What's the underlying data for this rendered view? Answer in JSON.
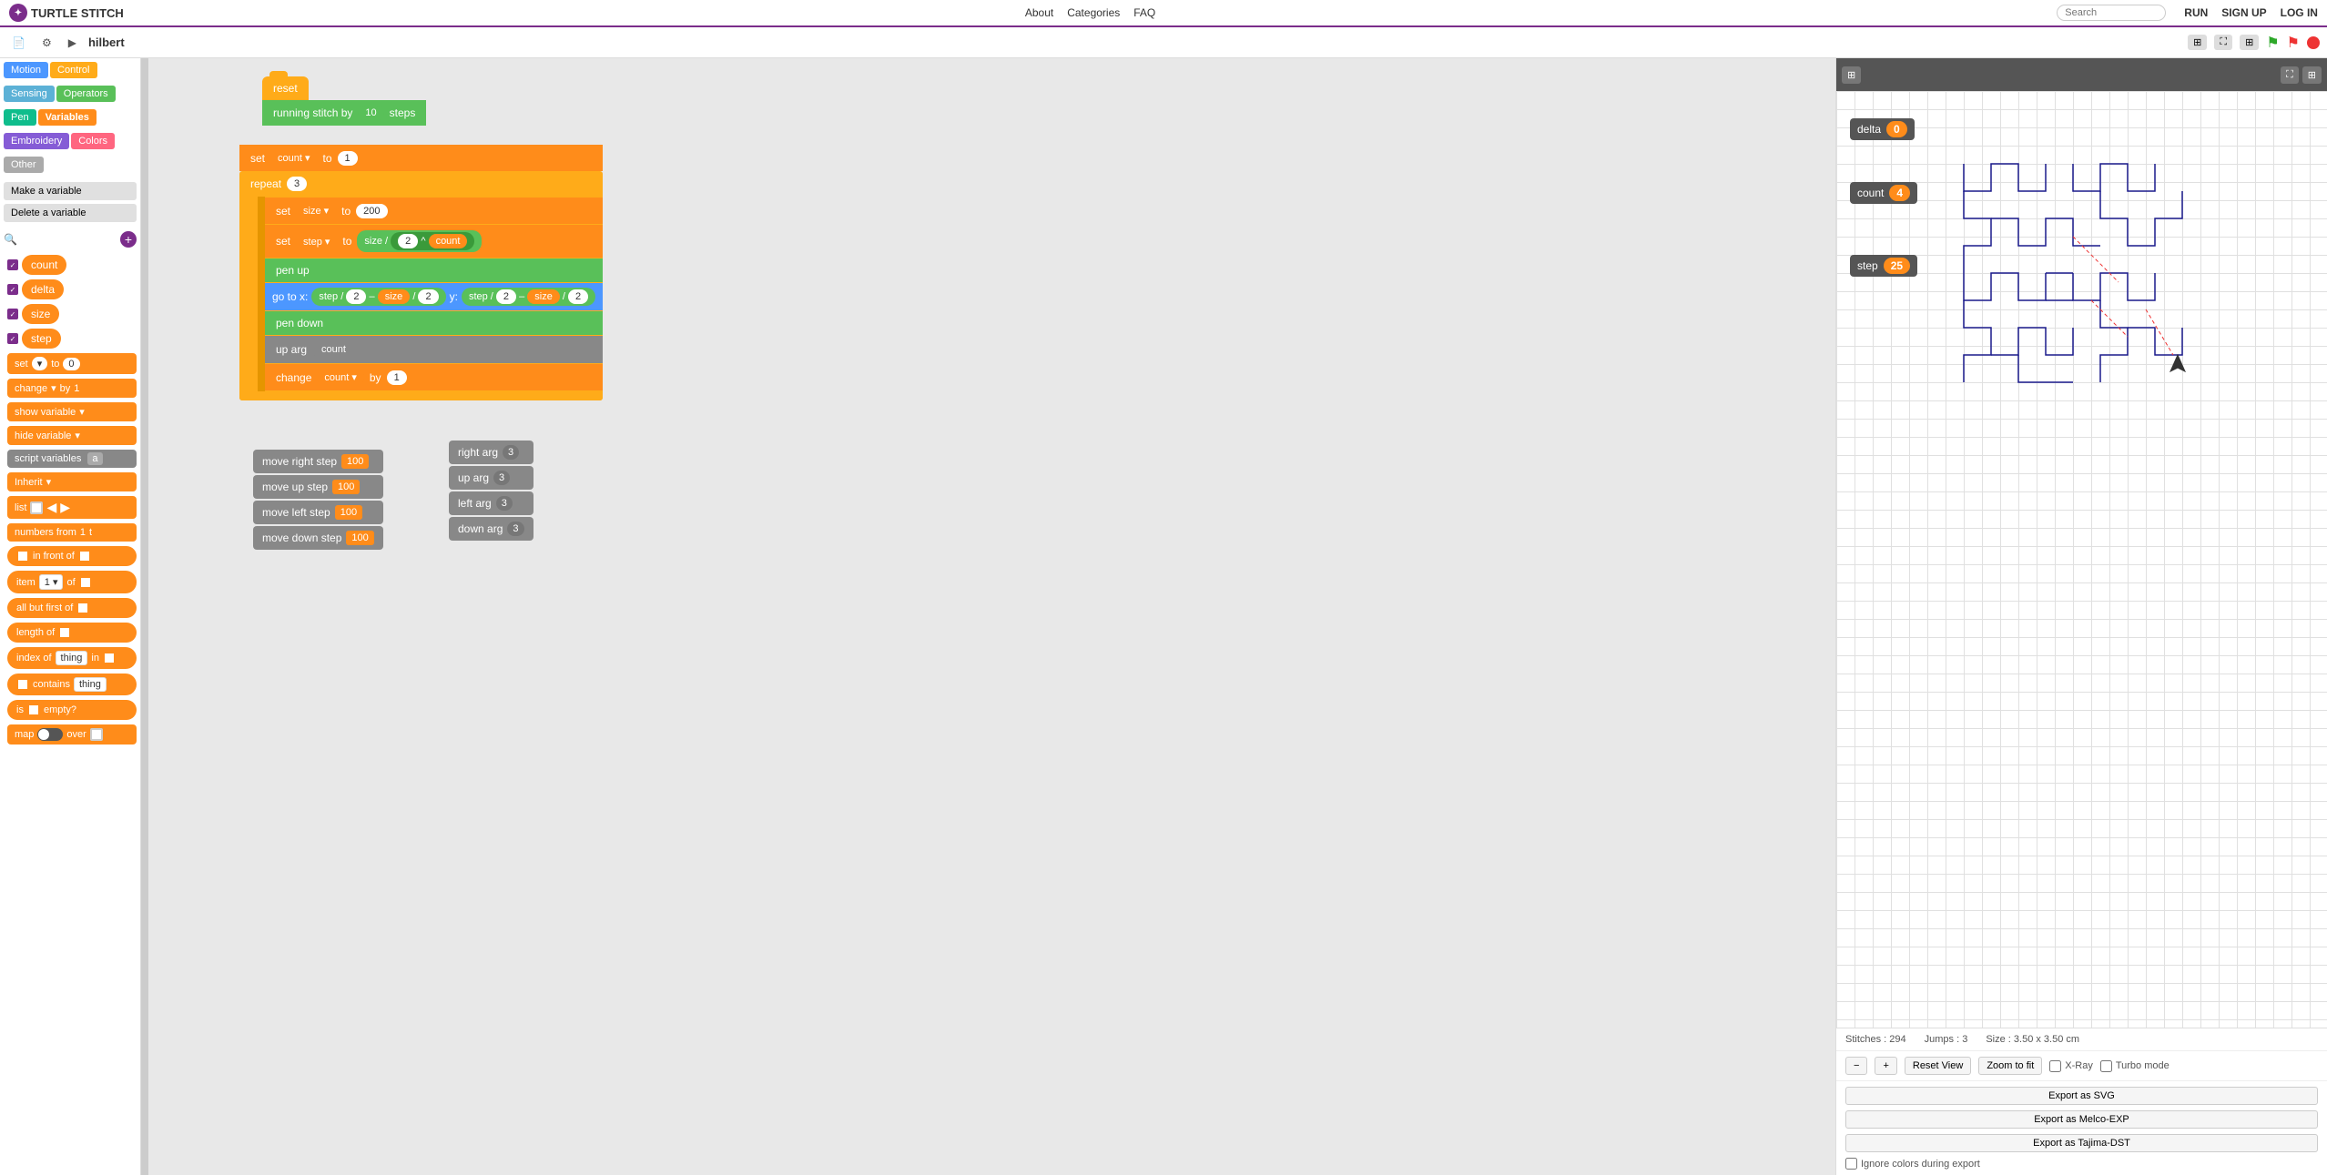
{
  "nav": {
    "logo": "TURTLE STITCH",
    "links": [
      "About",
      "Categories",
      "FAQ"
    ],
    "search_placeholder": "Search",
    "right_links": [
      "RUN",
      "SIGN UP",
      "LOG IN"
    ]
  },
  "toolbar": {
    "filename": "hilbert",
    "icons": [
      "new",
      "settings",
      "play"
    ]
  },
  "categories": {
    "items": [
      {
        "label": "Motion",
        "type": "motion"
      },
      {
        "label": "Control",
        "type": "control"
      },
      {
        "label": "Sensing",
        "type": "sensing"
      },
      {
        "label": "Operators",
        "type": "operators"
      },
      {
        "label": "Pen",
        "type": "pen"
      },
      {
        "label": "Variables",
        "type": "variables"
      },
      {
        "label": "Embroidery",
        "type": "embroidery"
      },
      {
        "label": "Colors",
        "type": "colors"
      },
      {
        "label": "Other",
        "type": "other"
      }
    ]
  },
  "var_actions": {
    "make": "Make a variable",
    "delete": "Delete a variable"
  },
  "variables": {
    "count": "count",
    "delta": "delta",
    "size": "size",
    "step": "step"
  },
  "blocks": {
    "set_label": "set",
    "set_to": "to",
    "set_val": "0",
    "change_label": "change",
    "change_by": "by",
    "change_val": "1",
    "show_var": "show variable",
    "hide_var": "hide variable",
    "script_vars": "script variables",
    "script_var_name": "a",
    "inherit": "Inherit",
    "list": "list",
    "numbers_from": "numbers from",
    "in_front_of": "in front of",
    "item": "item",
    "item_num": "1",
    "item_of": "of",
    "all_but_first": "all but first of",
    "length_of": "length of",
    "index_of": "index of",
    "index_thing": "thing",
    "index_in": "in",
    "contains": "contains",
    "contains_thing": "thing",
    "is_empty": "is",
    "is_empty_label": "empty?",
    "map": "map",
    "map_over": "over"
  },
  "canvas": {
    "reset_block": "reset",
    "running_stitch": "running stitch by",
    "running_stitch_val": "10",
    "running_stitch_unit": "steps",
    "set1_var": "count",
    "set1_val": "1",
    "repeat_val": "3",
    "set2_var": "size",
    "set2_val": "200",
    "set3_var": "step",
    "set3_label": "size",
    "set3_div": "/",
    "set3_num": "2",
    "set3_op": "^",
    "set3_count": "count",
    "pen_up": "pen up",
    "goto_label": "go to x:",
    "goto_x_step": "step",
    "goto_x_div": "/",
    "goto_x_2": "2",
    "goto_x_minus": "–",
    "goto_x_size": "size",
    "goto_x_div2": "/",
    "goto_x_2b": "2",
    "goto_y_label": "y:",
    "goto_y_step": "step",
    "goto_y_div": "/",
    "goto_y_2": "2",
    "goto_y_minus": "–",
    "goto_y_size": "size",
    "goto_y_div2": "/",
    "goto_y_2b": "2",
    "pen_down": "pen down",
    "up_arg_count": "count",
    "change_count_val": "1",
    "move_right": "move right step",
    "move_right_val": "100",
    "move_up": "move up step",
    "move_up_val": "100",
    "move_left": "move left step",
    "move_left_val": "100",
    "move_down": "move down step",
    "move_down_val": "100",
    "right_arg_val": "3",
    "up_arg_val": "3",
    "left_arg_val": "3",
    "down_arg_val": "3"
  },
  "preview": {
    "delta_label": "delta",
    "delta_val": "0",
    "count_label": "count",
    "count_val": "4",
    "step_label": "step",
    "step_val": "25",
    "stitches": "Stitches : 294",
    "jumps": "Jumps : 3",
    "size": "Size : 3.50 x 3.50 cm",
    "reset_view": "Reset View",
    "zoom_fit": "Zoom to fit",
    "export_svg": "Export as SVG",
    "export_melco": "Export as Melco-EXP",
    "export_tajima": "Export as Tajima-DST",
    "xray_label": "X-Ray",
    "turbo_label": "Turbo mode",
    "ignore_colors": "Ignore colors during export"
  }
}
